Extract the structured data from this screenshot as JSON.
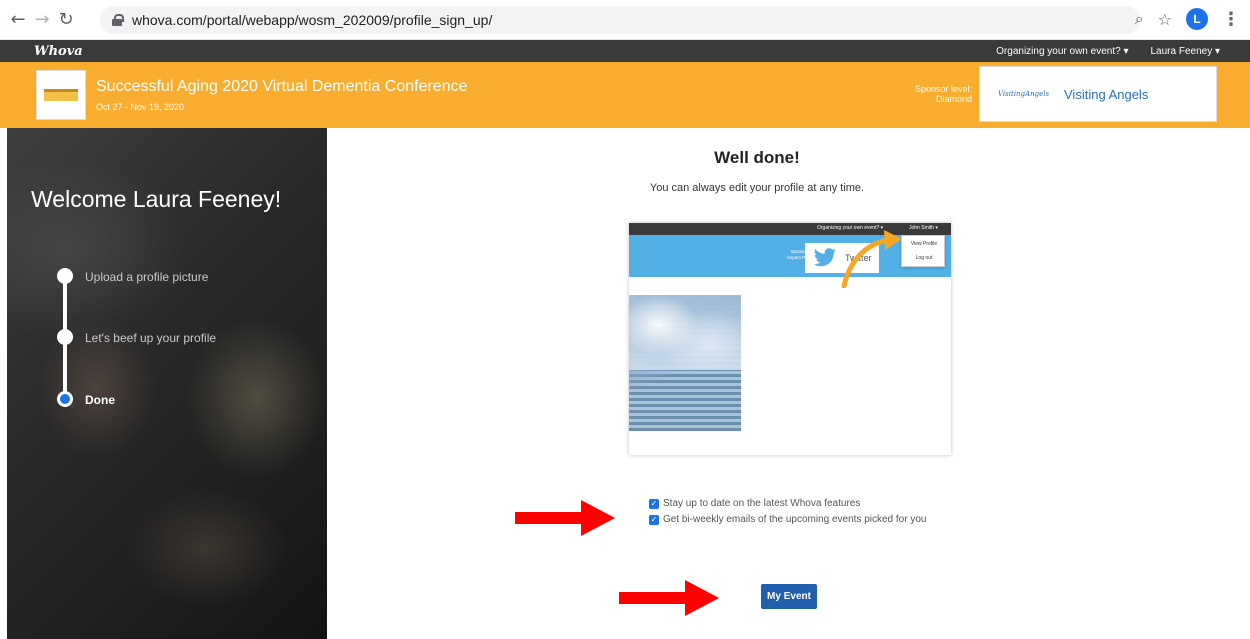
{
  "browser": {
    "url": "whova.com/portal/webapp/wosm_202009/profile_sign_up/",
    "avatar_initial": "L"
  },
  "topbar": {
    "logo": "Whova",
    "organize_link": "Organizing your own event? ▾",
    "user_menu": "Laura Feeney ▾"
  },
  "event": {
    "title": "Successful Aging 2020 Virtual Dementia Conference",
    "dates": "Oct 27 - Nov 19, 2020",
    "sponsor_level_label": "Sponsor level:",
    "sponsor_level": "Diamond",
    "sponsor_logo_text": "VisitingAngels",
    "sponsor_name": "Visiting Angels",
    "banner_color": "#f8ad2e"
  },
  "sidebar": {
    "welcome": "Welcome Laura Feeney!",
    "steps": [
      {
        "label": "Upload a profile picture",
        "state": "complete"
      },
      {
        "label": "Let's beef up your profile",
        "state": "complete"
      },
      {
        "label": "Done",
        "state": "active"
      }
    ]
  },
  "main": {
    "heading": "Well done!",
    "note": "You can always edit your profile at any time.",
    "preview": {
      "organize_link": "Organizing your own event? ▾",
      "user_menu": "John Smith ▾",
      "sponsor_level_label": "Sponsor level:",
      "sponsor_level": "Impact Partners",
      "sponsor_name": "Twitter",
      "menu_items": [
        "View Profile",
        "Log out"
      ]
    },
    "checkboxes": [
      {
        "label": "Stay up to date on the latest Whova features",
        "checked": true
      },
      {
        "label": "Get bi-weekly emails of the upcoming events picked for you",
        "checked": true
      }
    ],
    "button_label": "My Event"
  },
  "colors": {
    "accent_blue": "#1f5fae",
    "arrow_red": "#ff0000",
    "twitter_blue": "#53b0e7"
  }
}
